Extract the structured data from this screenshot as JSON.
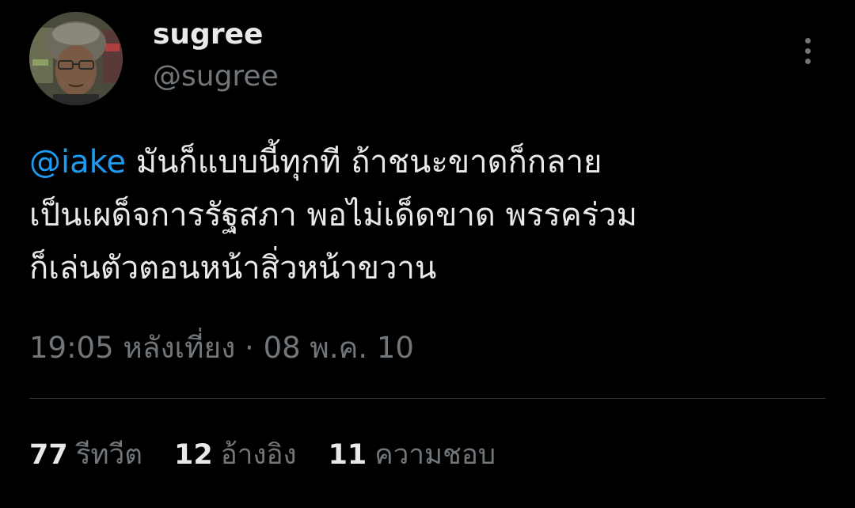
{
  "user": {
    "display_name": "sugree",
    "handle": "@sugree"
  },
  "tweet": {
    "mention": "@iake",
    "line1_rest": " มันก็แบบนี้ทุกที ถ้าชนะขาดก็กลาย",
    "line2": "เป็นเผด็จการรัฐสภา พอไม่เด็ดขาด พรรคร่วม",
    "line3": "ก็เล่นตัวตอนหน้าสิ่วหน้าขวาน"
  },
  "timestamp": "19:05 หลังเที่ยง · 08 พ.ค. 10",
  "stats": {
    "retweets": {
      "count": "77",
      "label": "รีทวีต"
    },
    "quotes": {
      "count": "12",
      "label": "อ้างอิง"
    },
    "likes": {
      "count": "11",
      "label": "ความชอบ"
    }
  },
  "icons": {
    "more": "more-options-icon",
    "avatar": "profile-photo"
  },
  "colors": {
    "background": "#000000",
    "text": "#e7e9ea",
    "secondary": "#71767b",
    "link": "#1d9bf0",
    "divider": "#2f3336"
  }
}
